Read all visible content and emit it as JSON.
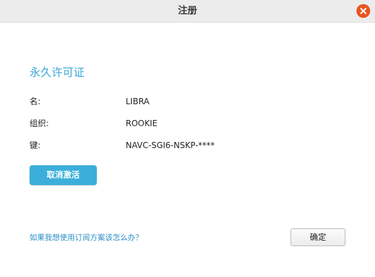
{
  "window": {
    "title": "注册",
    "close_icon": "close-icon"
  },
  "license": {
    "section_title": "永久许可证",
    "fields": [
      {
        "label": "名:",
        "value": "LIBRA"
      },
      {
        "label": "组织:",
        "value": "ROOKIE"
      },
      {
        "label": "键:",
        "value": "NAVC-SGI6-NSKP-****"
      }
    ],
    "deactivate_label": "取消激活"
  },
  "footer": {
    "help_link": "如果我想使用订阅方案该怎么办？",
    "ok_label": "确定"
  },
  "colors": {
    "accent": "#3bafda",
    "link": "#2d8fc8",
    "close": "#e95420"
  }
}
